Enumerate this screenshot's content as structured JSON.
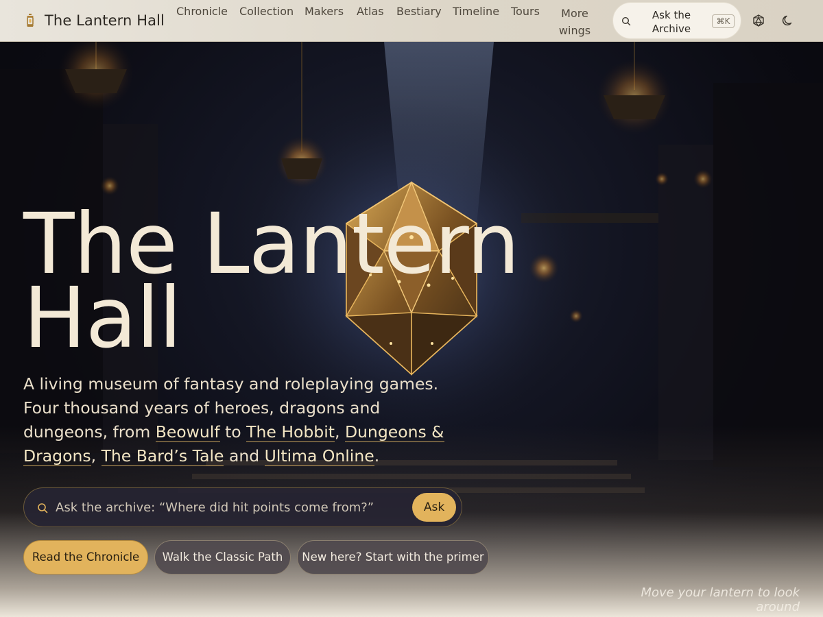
{
  "header": {
    "brand_title": "The Lantern Hall",
    "nav": [
      "Chronicle",
      "Collection",
      "Makers",
      "Atlas",
      "Bestiary",
      "Timeline",
      "Tours"
    ],
    "more_line1": "More",
    "more_line2": "wings",
    "ask_label": "Ask the Archive",
    "ask_shortcut": "⌘K",
    "icons": [
      "lantern-icon",
      "search-icon",
      "d20-icon",
      "moon-icon"
    ]
  },
  "hero": {
    "title_line1": "The Lantern",
    "title_line2": "Hall",
    "desc_intro": "A living museum of fantasy and roleplaying games. Four thousand years of heroes, dragons and dungeons, from",
    "links": [
      "Beowulf",
      "The Hobbit",
      "Dungeons & Dragons",
      "The Bard’s Tale",
      "Ultima Online"
    ],
    "sep_to": "to",
    "sep_comma": ",",
    "sep_and": "and",
    "sep_period": ".",
    "search_placeholder": "Ask the archive: “Where did hit points come from?”",
    "search_button": "Ask",
    "cta_primary": "Read the Chronicle",
    "cta_secondary": "Walk the Classic Path",
    "cta_primer": "New here? Start with the primer",
    "hint": "Move your lantern to look around"
  },
  "colors": {
    "accent_gold": "#e2b35c",
    "header_bg": "#e6e1d7",
    "hero_text": "#f3e9d6"
  }
}
